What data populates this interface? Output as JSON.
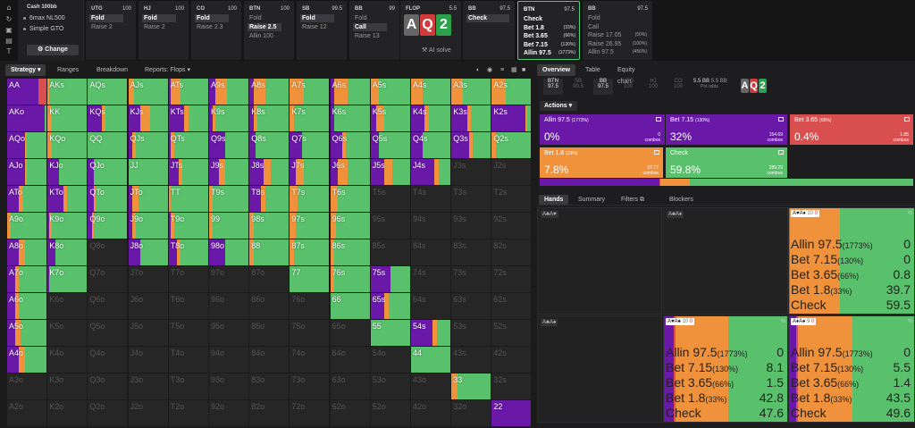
{
  "colors": {
    "green": "#59c06b",
    "orange": "#ef923b",
    "purple": "#6a18a8",
    "red": "#d94f4f",
    "empty": "#262627"
  },
  "session": {
    "title": "Cash 100bb",
    "items": [
      "6max NL500",
      "Simple GTO"
    ],
    "change_label": "Change"
  },
  "positions": [
    {
      "name": "UTG",
      "stack": "100",
      "actions": [
        {
          "label": "Fold",
          "sel": true
        },
        {
          "label": "Raise 2",
          "sel": false
        }
      ]
    },
    {
      "name": "HJ",
      "stack": "100",
      "actions": [
        {
          "label": "Fold",
          "sel": true
        },
        {
          "label": "Raise 2",
          "sel": false
        }
      ]
    },
    {
      "name": "CO",
      "stack": "100",
      "actions": [
        {
          "label": "Fold",
          "sel": true
        },
        {
          "label": "Raise 2.3",
          "sel": false
        }
      ]
    },
    {
      "name": "BTN",
      "stack": "100",
      "actions": [
        {
          "label": "Fold",
          "sel": false
        },
        {
          "label": "Raise 2.5",
          "sel": true
        },
        {
          "label": "Allin 100",
          "sel": false
        }
      ]
    },
    {
      "name": "SB",
      "stack": "99.5",
      "actions": [
        {
          "label": "Fold",
          "sel": true
        },
        {
          "label": "Raise 12",
          "sel": false
        }
      ]
    },
    {
      "name": "BB",
      "stack": "99",
      "actions": [
        {
          "label": "Fold",
          "sel": false
        },
        {
          "label": "Call",
          "sel": true
        },
        {
          "label": "Raise 13",
          "sel": false
        }
      ]
    }
  ],
  "flop": {
    "name": "FLOP",
    "pot": "5.5",
    "cards": [
      {
        "r": "A",
        "c": "#666"
      },
      {
        "r": "Q",
        "c": "#d13b3b"
      },
      {
        "r": "2",
        "c": "#2aa14a"
      }
    ],
    "ai": "AI solve"
  },
  "bb_check": {
    "name": "BB",
    "stack": "97.5",
    "action": "Check"
  },
  "btn_decision": {
    "name": "BTN",
    "stack": "97.5",
    "actions": [
      {
        "label": "Check",
        "pct": ""
      },
      {
        "label": "Bet 1.8",
        "pct": "(33%)"
      },
      {
        "label": "Bet 3.65",
        "pct": "(66%)"
      },
      {
        "label": "Bet 7.15",
        "pct": "(130%)"
      },
      {
        "label": "Allin 97.5",
        "pct": "(1773%)"
      }
    ]
  },
  "bb_next": {
    "name": "BB",
    "stack": "97.5",
    "actions": [
      {
        "label": "Fold",
        "pct": ""
      },
      {
        "label": "Call",
        "pct": ""
      },
      {
        "label": "Raise 17.05",
        "pct": "(50%)"
      },
      {
        "label": "Raise 26.95",
        "pct": "(100%)"
      },
      {
        "label": "Allin 97.5",
        "pct": "(456%)"
      }
    ]
  },
  "left_tabs": [
    "Strategy",
    "Ranges",
    "Breakdown",
    "Reports: Flops"
  ],
  "right_tabs": [
    "Overview",
    "Table",
    "Equity chart"
  ],
  "mini_pos": [
    {
      "n": "BTN",
      "v": "97.5",
      "on": true
    },
    {
      "n": "SB",
      "v": "99.5",
      "on": false
    },
    {
      "n": "BB",
      "v": "97.5",
      "on": true
    },
    {
      "n": "UTG",
      "v": "100",
      "on": false
    },
    {
      "n": "HJ",
      "v": "100",
      "on": false
    },
    {
      "n": "CO",
      "v": "100",
      "on": false
    }
  ],
  "pot_info": {
    "pot": "5.5 BB",
    "pot2": "5.5 BB",
    "odds": "Pot odds"
  },
  "actions_label": "Actions",
  "action_boxes": [
    {
      "name": "Allin 97.5",
      "sz": "(1773%)",
      "pct": "0%",
      "combos": "0",
      "cl": "combos",
      "bg": "#6a18a8"
    },
    {
      "name": "Bet 7.15",
      "sz": "(130%)",
      "pct": "32%",
      "combos": "154.69",
      "cl": "combos",
      "bg": "#6a18a8"
    },
    {
      "name": "Bet 3.65",
      "sz": "(66%)",
      "pct": "0.4%",
      "combos": "1.85",
      "cl": "combos",
      "bg": "#d94f4f"
    },
    {
      "name": "Bet 1.8",
      "sz": "(33%)",
      "pct": "7.8%",
      "combos": "37.77",
      "cl": "combos",
      "bg": "#ef923b"
    },
    {
      "name": "Check",
      "sz": "",
      "pct": "59.8%",
      "combos": "289.29",
      "cl": "combos",
      "bg": "#59c06b"
    }
  ],
  "strategy_bar": [
    {
      "v": 0.32,
      "c": "#6a18a8"
    },
    {
      "v": 0.004,
      "c": "#d94f4f"
    },
    {
      "v": 0.078,
      "c": "#ef923b"
    },
    {
      "v": 0.598,
      "c": "#59c06b"
    }
  ],
  "lower_tabs": [
    "Hands",
    "Summary",
    "Filters",
    "Blockers"
  ],
  "hand_cells": [
    {
      "label": "A♣A♥",
      "active": false
    },
    {
      "label": "A♣A♦",
      "active": false
    },
    {
      "label": "A♥A♦",
      "active": true,
      "pct": "%",
      "w": "10",
      "b": "0",
      "stats": [
        {
          "a": "Allin 97.5",
          "s": "(1773%)",
          "v": "0"
        },
        {
          "a": "Bet 7.15",
          "s": "(130%)",
          "v": "0"
        },
        {
          "a": "Bet 3.65",
          "s": "(66%)",
          "v": "0.8"
        },
        {
          "a": "Bet 1.8",
          "s": "(33%)",
          "v": "39.7"
        },
        {
          "a": "Check",
          "s": "",
          "v": "59.5"
        }
      ],
      "mix": [
        0,
        0,
        0.008,
        0.397,
        0.595
      ]
    },
    {
      "label": "A♣A♠",
      "active": false
    },
    {
      "label": "A♥A♠",
      "active": true,
      "pct": "%",
      "w": "10",
      "b": "0",
      "stats": [
        {
          "a": "Allin 97.5",
          "s": "(1773%)",
          "v": "0"
        },
        {
          "a": "Bet 7.15",
          "s": "(130%)",
          "v": "8.1"
        },
        {
          "a": "Bet 3.65",
          "s": "(66%)",
          "v": "1.5"
        },
        {
          "a": "Bet 1.8",
          "s": "(33%)",
          "v": "42.8"
        },
        {
          "a": "Check",
          "s": "",
          "v": "47.6"
        }
      ],
      "mix": [
        0,
        0.081,
        0.015,
        0.428,
        0.476
      ]
    },
    {
      "label": "A♦A♠",
      "active": true,
      "pct": "%",
      "w": "9",
      "b": "0",
      "stats": [
        {
          "a": "Allin 97.5",
          "s": "(1773%)",
          "v": "0"
        },
        {
          "a": "Bet 7.15",
          "s": "(130%)",
          "v": "5.5"
        },
        {
          "a": "Bet 3.65",
          "s": "(66%)",
          "v": "1.4"
        },
        {
          "a": "Bet 1.8",
          "s": "(33%)",
          "v": "43.5"
        },
        {
          "a": "Check",
          "s": "",
          "v": "49.6"
        }
      ],
      "mix": [
        0,
        0.055,
        0.014,
        0.435,
        0.496
      ]
    }
  ],
  "grid": [
    [
      "AA:.68,.12,.2,.7",
      "AKs:0,0,0,.05,.95",
      "AQs:0,0,0,0,1",
      "AJs:0,0,0,.15,.85",
      "ATs:0,.05,0,.25,.7",
      "A9s:0,.15,0,.3,.55",
      "A8s:0,.1,0,.3,.6",
      "A7s:0,0,0,.35,.65",
      "A6s:0,.1,0,.35,.55",
      "A5s:0,0,0,.2,.8",
      "A4s:0,0,0,.3,.7",
      "A3s:0,0,0,.3,.7",
      "A2s:0,0,0,.35,.65"
    ],
    [
      "AKo:0,.95,0,0,.05",
      "KK:0,0,0,.1,.9",
      "KQs:0,.35,0,.1,.55",
      "KJs:0,.3,0,.25,.45",
      "KTs:0,.4,0,.1,.5",
      "K9s:0,.1,0,.05,.85",
      "K8s:0,.1,0,.1,.8",
      "K7s:0,0,0,.1,.9",
      "K6s:0,.1,0,0,.9",
      "K5s:0,.15,0,.2,.65",
      "K4s:0,.35,0,.1,.55",
      "K3s:0,.4,0,.1,.5",
      "K2s:0,.85,0,.05,.1"
    ],
    [
      "AQo:0,.45,0,.05,.5",
      "KQo:0,0,0,.1,.9",
      "QQ:0,0,0,0,1",
      "QJs:0,.1,0,.1,.8",
      "QTs:0,.05,0,.1,.85",
      "Q9s:0,.4,0,0,.6",
      "Q8s:0,.15,0,0,.85",
      "Q7s:0,.3,0,0,.7",
      "Q6s:0,.3,0,.1,.6",
      "Q5s:0,.2,0,0,.8",
      "Q4s:0,.3,0,0,.7",
      "Q3s:0,.45,0,.1,.45",
      "Q2s:0,0,0,.1,.9"
    ],
    [
      "AJo:0,.45,0,.05,.5",
      "KJo:0,.3,0,0,.7",
      "QJo:0,.15,0,0,.85",
      "JJ:0,0,0,0,1",
      "JTs:0,.25,0,.1,.65",
      "J9s:0,.25,0,.15,.6",
      "J8s:0,.35,0,.2,.45",
      "J7s:0,.15,0,.2,.65",
      "J6s:0,.2,0,.25,.55",
      "J5s:0,.35,0,.2,.45",
      "J4s:0,.6,0,.1,.3",
      "J3s:",
      "J2s:"
    ],
    [
      "ATo:0,.3,0,.1,.6",
      "KTo:0,.4,0,.1,.5",
      "QTo:0,.15,0,.05,.8",
      "JTo:0,.1,0,.15,.75",
      "TT:0,0,0,.05,.95",
      "T9s:0,0,0,.1,.9",
      "T8s:0,.3,0,.1,.6",
      "T7s:0,0,0,.2,.8",
      "T6s:0,0,0,.2,.8",
      "T5s:",
      "T4s:",
      "T3s:",
      "T2s:"
    ],
    [
      "A9o:0,0,0,.1,.9",
      "K9o:0,.05,0,.05,.9",
      "Q9o:0,.1,0,.05,.85",
      "J9o:0,.1,0,.1,.8",
      "T9o:0,.05,0,.1,.85",
      "99:0,0,0,.1,.9",
      "98s:0,0,0,.1,.9",
      "97s:0,0,0,.15,.85",
      "96s:0,0,0,.15,.85",
      "95s:",
      "94s:",
      "93s:",
      "92s:"
    ],
    [
      "A8o:0,.3,0,.15,.55",
      "K8o:0,.2,0,0,.8",
      "Q8o:",
      "J8o:0,.3,0,0,.7",
      "T8o:0,.2,0,.1,.7",
      "98o:0,.4,0,0,.6",
      "88:0,0,0,.1,.9",
      "87s:0,0,0,.1,.9",
      "86s:0,0,0,.1,.9",
      "85s:",
      "84s:",
      "83s:",
      "82s:"
    ],
    [
      "A7o:0,.2,0,.1,.7",
      "K7o:0,.05,0,0,.95",
      "Q7o:",
      "J7o:",
      "T7o:",
      "97o:",
      "87o:",
      "77:0,0,0,0,1",
      "76s:0,0,0,.1,.9",
      "75s:0,.5,0,0,.5",
      "74s:",
      "73s:",
      "72s:"
    ],
    [
      "A6o:0,.2,0,.1,.7",
      "K6o:",
      "Q6o:",
      "J6o:",
      "T6o:",
      "96o:",
      "86o:",
      "76o:",
      "66:0,0,0,0,1",
      "65s:0,.35,0,.1,.55",
      "64s:",
      "63s:",
      "62s:"
    ],
    [
      "A5o:0,.2,0,.15,.65",
      "K5o:",
      "Q5o:",
      "J5o:",
      "T5o:",
      "95o:",
      "85o:",
      "75o:",
      "65o:",
      "55:0,0,0,0,1",
      "54s:0,.55,0,.1,.35",
      "53s:",
      "52s:"
    ],
    [
      "A4o:0,.3,0,.15,.55",
      "K4o:",
      "Q4o:",
      "J4o:",
      "T4o:",
      "94o:",
      "84o:",
      "74o:",
      "64o:",
      "54o:",
      "44:0,0,0,0,1",
      "43s:",
      "42s:"
    ],
    [
      "A3o:",
      "K3o:",
      "Q3o:",
      "J3o:",
      "T3o:",
      "93o:",
      "83o:",
      "73o:",
      "63o:",
      "53o:",
      "43o:",
      "33:0,0,0,.15,.85",
      "32s:"
    ],
    [
      "A2o:",
      "K2o:",
      "Q2o:",
      "J2o:",
      "T2o:",
      "92o:",
      "82o:",
      "72o:",
      "62o:",
      "52o:",
      "42o:",
      "32o:",
      "22:0,1,0,0,0"
    ]
  ]
}
